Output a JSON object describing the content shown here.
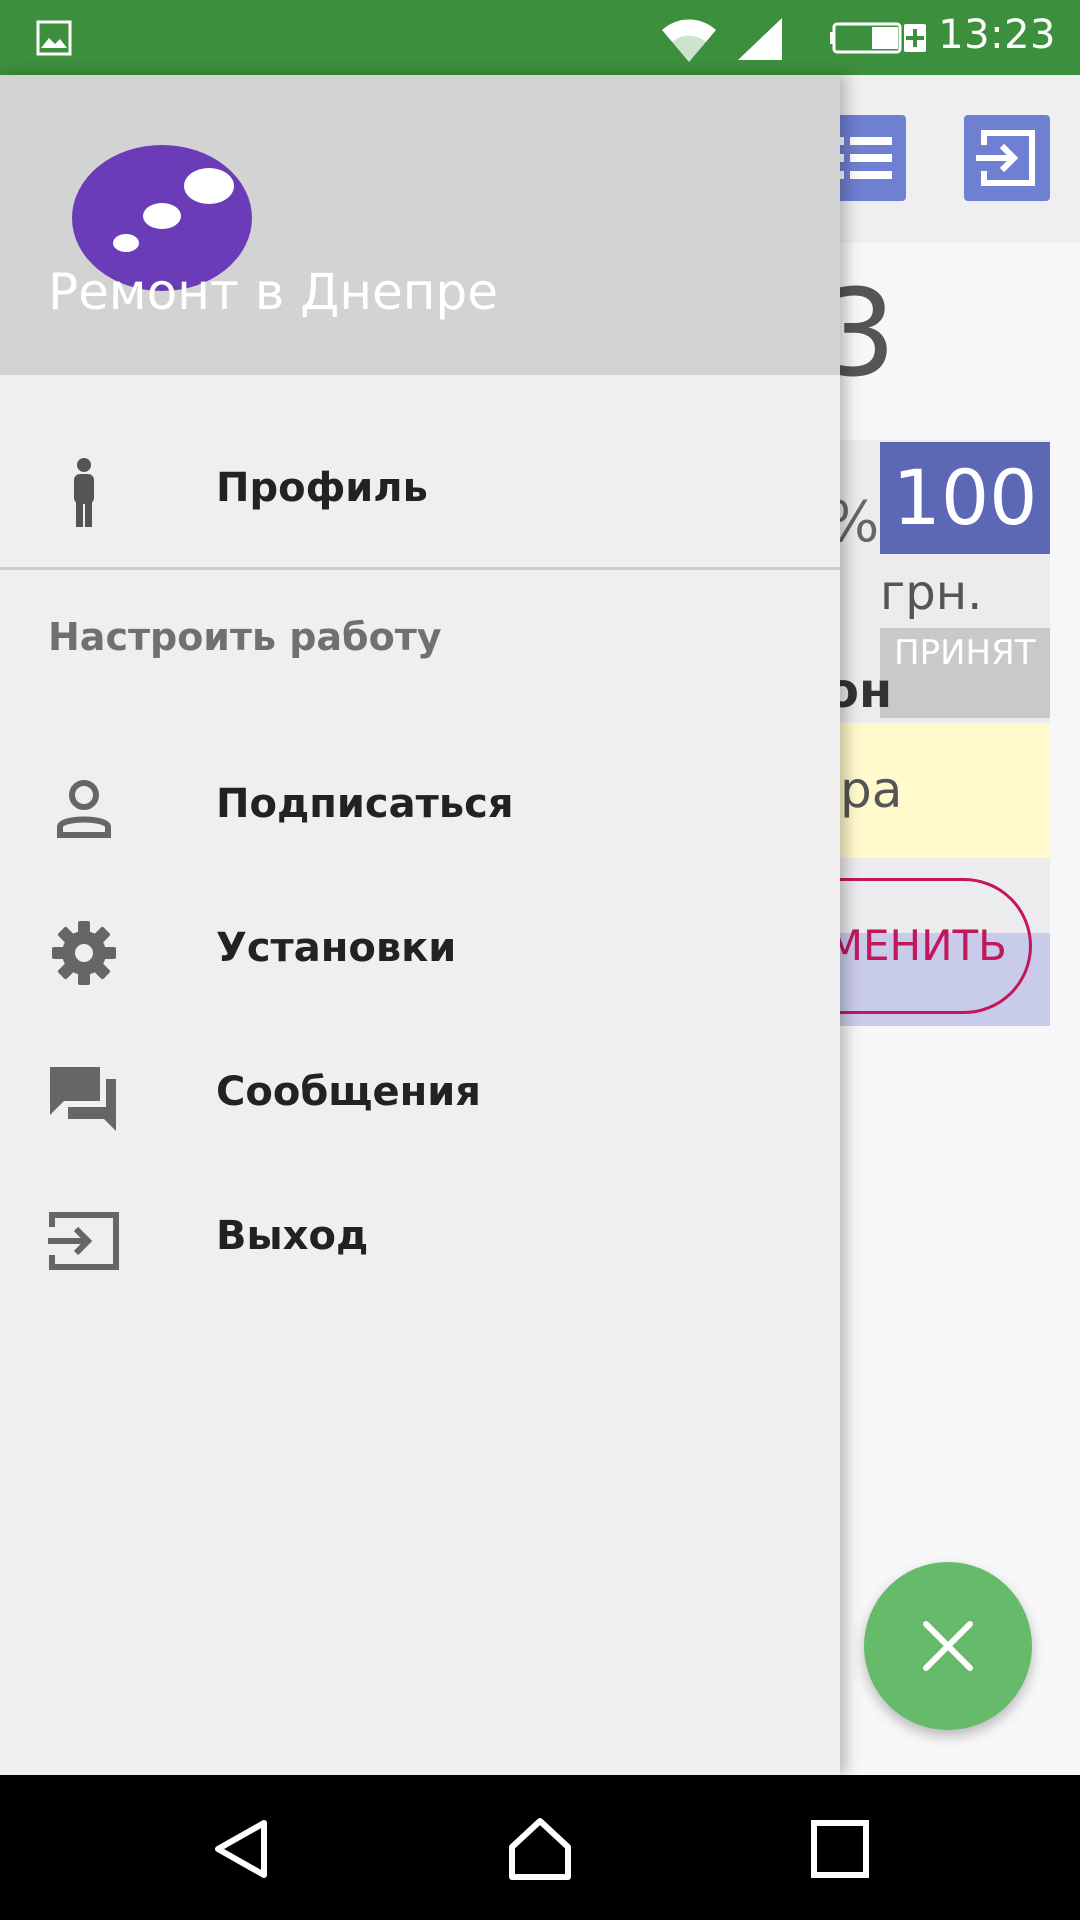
{
  "status_bar": {
    "time": "13:23",
    "icons": [
      "gallery-icon",
      "wifi-icon",
      "signal-icon",
      "battery-charging-icon"
    ]
  },
  "background": {
    "big_count": "3",
    "percent_partial": "%",
    "price": "100",
    "currency": "грн.",
    "status_label": "ПРИНЯТ",
    "bold_partial": "он",
    "yellow_partial": "ра",
    "cancel_button_partial": "ЕМЕНИТЬ",
    "toolbar_icons": [
      "list-icon",
      "exit-icon"
    ],
    "fab_icon": "close-icon",
    "colors": {
      "toolbar_button": "#6f7fd1",
      "price_box": "#5c67b6",
      "fab": "#66bb6a",
      "cancel_outline": "#c2185b"
    }
  },
  "drawer": {
    "header_title": "Ремонт в Днепре",
    "profile_label": "Профиль",
    "section_title": "Настроить работу",
    "items": [
      {
        "label": "Подписаться",
        "icon": "person-icon"
      },
      {
        "label": "Установки",
        "icon": "gear-icon"
      },
      {
        "label": "Сообщения",
        "icon": "chat-icon"
      },
      {
        "label": "Выход",
        "icon": "exit-icon"
      }
    ],
    "colors": {
      "header_bg": "#d3d3d3",
      "drawer_bg": "#efefef",
      "logo": "#6a3cb8"
    }
  },
  "nav_bar": {
    "icons": [
      "back-icon",
      "home-icon",
      "recent-apps-icon"
    ]
  },
  "theme": {
    "status_bar": "#3b8f3d"
  }
}
